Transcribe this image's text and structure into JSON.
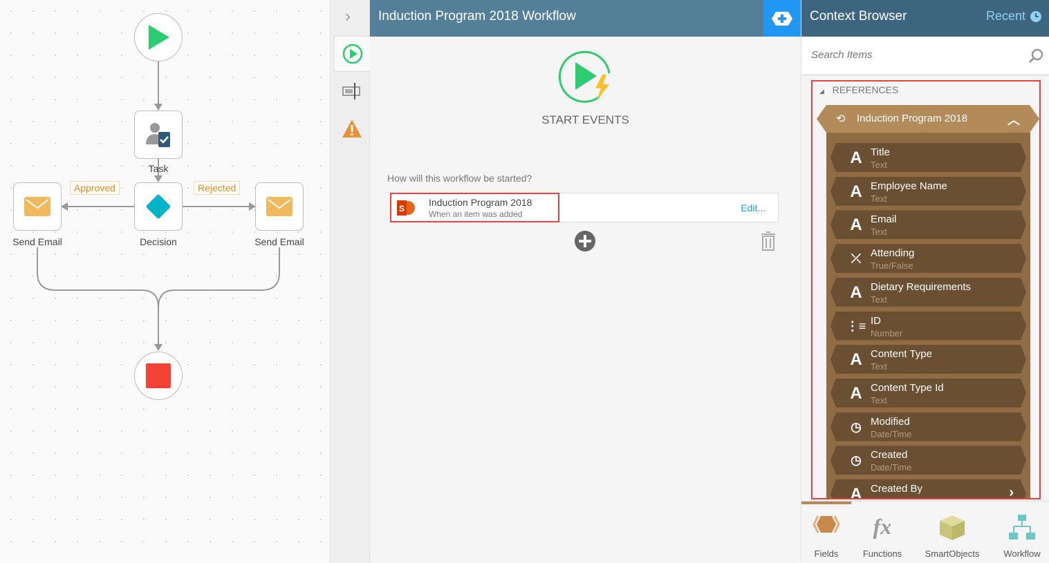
{
  "canvas": {
    "nodes": {
      "task": "Task",
      "decision": "Decision",
      "send_email_left": "Send Email",
      "send_email_right": "Send Email"
    },
    "branches": {
      "approved": "Approved",
      "rejected": "Rejected"
    }
  },
  "main": {
    "title": "Induction Program 2018 Workflow",
    "section": "START EVENTS",
    "question": "How will this workflow be started?",
    "event": {
      "name": "Induction Program 2018",
      "desc": "When an item was added",
      "edit": "Edit..."
    }
  },
  "context": {
    "title": "Context Browser",
    "recent": "Recent",
    "search_placeholder": "Search Items",
    "references": "REFERENCES",
    "group": "Induction Program 2018",
    "fields": [
      {
        "name": "Title",
        "type": "Text",
        "icon": "text-icon"
      },
      {
        "name": "Employee Name",
        "type": "Text",
        "icon": "text-icon"
      },
      {
        "name": "Email",
        "type": "Text",
        "icon": "text-icon"
      },
      {
        "name": "Attending",
        "type": "True/False",
        "icon": "boolean-icon"
      },
      {
        "name": "Dietary Requirements",
        "type": "Text",
        "icon": "text-icon"
      },
      {
        "name": "ID",
        "type": "Number",
        "icon": "number-icon"
      },
      {
        "name": "Content Type",
        "type": "Text",
        "icon": "text-icon"
      },
      {
        "name": "Content Type Id",
        "type": "Text",
        "icon": "text-icon"
      },
      {
        "name": "Modified",
        "type": "Date/Time",
        "icon": "datetime-icon"
      },
      {
        "name": "Created",
        "type": "Date/Time",
        "icon": "datetime-icon"
      },
      {
        "name": "Created By",
        "type": "",
        "icon": "text-icon"
      }
    ],
    "tabs": [
      "Fields",
      "Functions",
      "SmartObjects",
      "Workflow"
    ]
  },
  "colors": {
    "header": "#547f98",
    "accent": "#2196f3",
    "field_bg": "#6b4f33",
    "group_bg": "#b38a5a",
    "start": "#2ecc71",
    "end": "#f44336"
  }
}
